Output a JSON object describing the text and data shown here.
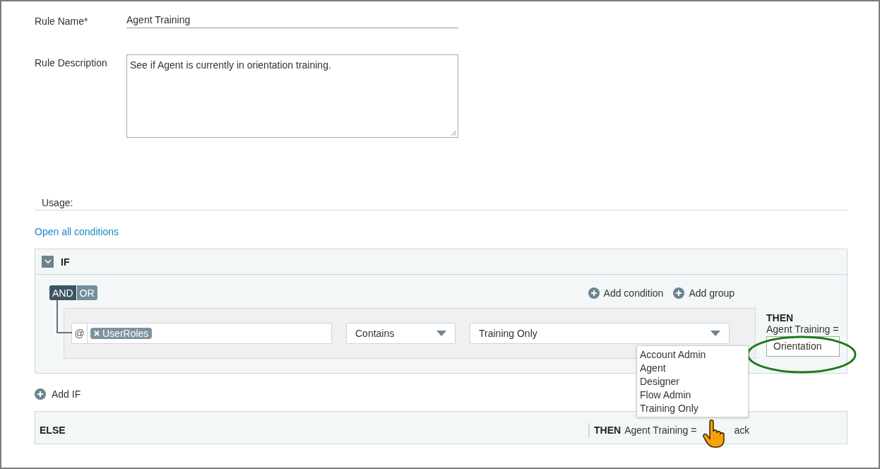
{
  "rule_name": {
    "label": "Rule Name*",
    "value": "Agent Training"
  },
  "rule_description": {
    "label": "Rule Description",
    "value": "See if Agent is currently in orientation training."
  },
  "usage": {
    "label": "Usage:"
  },
  "open_all_link": "Open all conditions",
  "if_block": {
    "title": "IF",
    "expanded": true,
    "operators": [
      {
        "label": "AND",
        "selected": true
      },
      {
        "label": "OR",
        "selected": false
      }
    ],
    "actions": [
      "Add condition",
      "Add group"
    ],
    "condition": {
      "attribute_prefix": "@",
      "attribute_tag": "UserRoles",
      "operator": "Contains",
      "value": "Training Only",
      "dropdown_open": true,
      "dropdown_options": [
        "Account Admin",
        "Agent",
        "Designer",
        "Flow Admin",
        "Training Only"
      ]
    },
    "then": {
      "label": "THEN",
      "target": "Agent Training =",
      "value": "Orientation",
      "highlighted": true
    }
  },
  "add_if": "Add IF",
  "else_block": {
    "label": "ELSE",
    "then_label": "THEN",
    "target": "Agent Training =",
    "value": "ack"
  }
}
